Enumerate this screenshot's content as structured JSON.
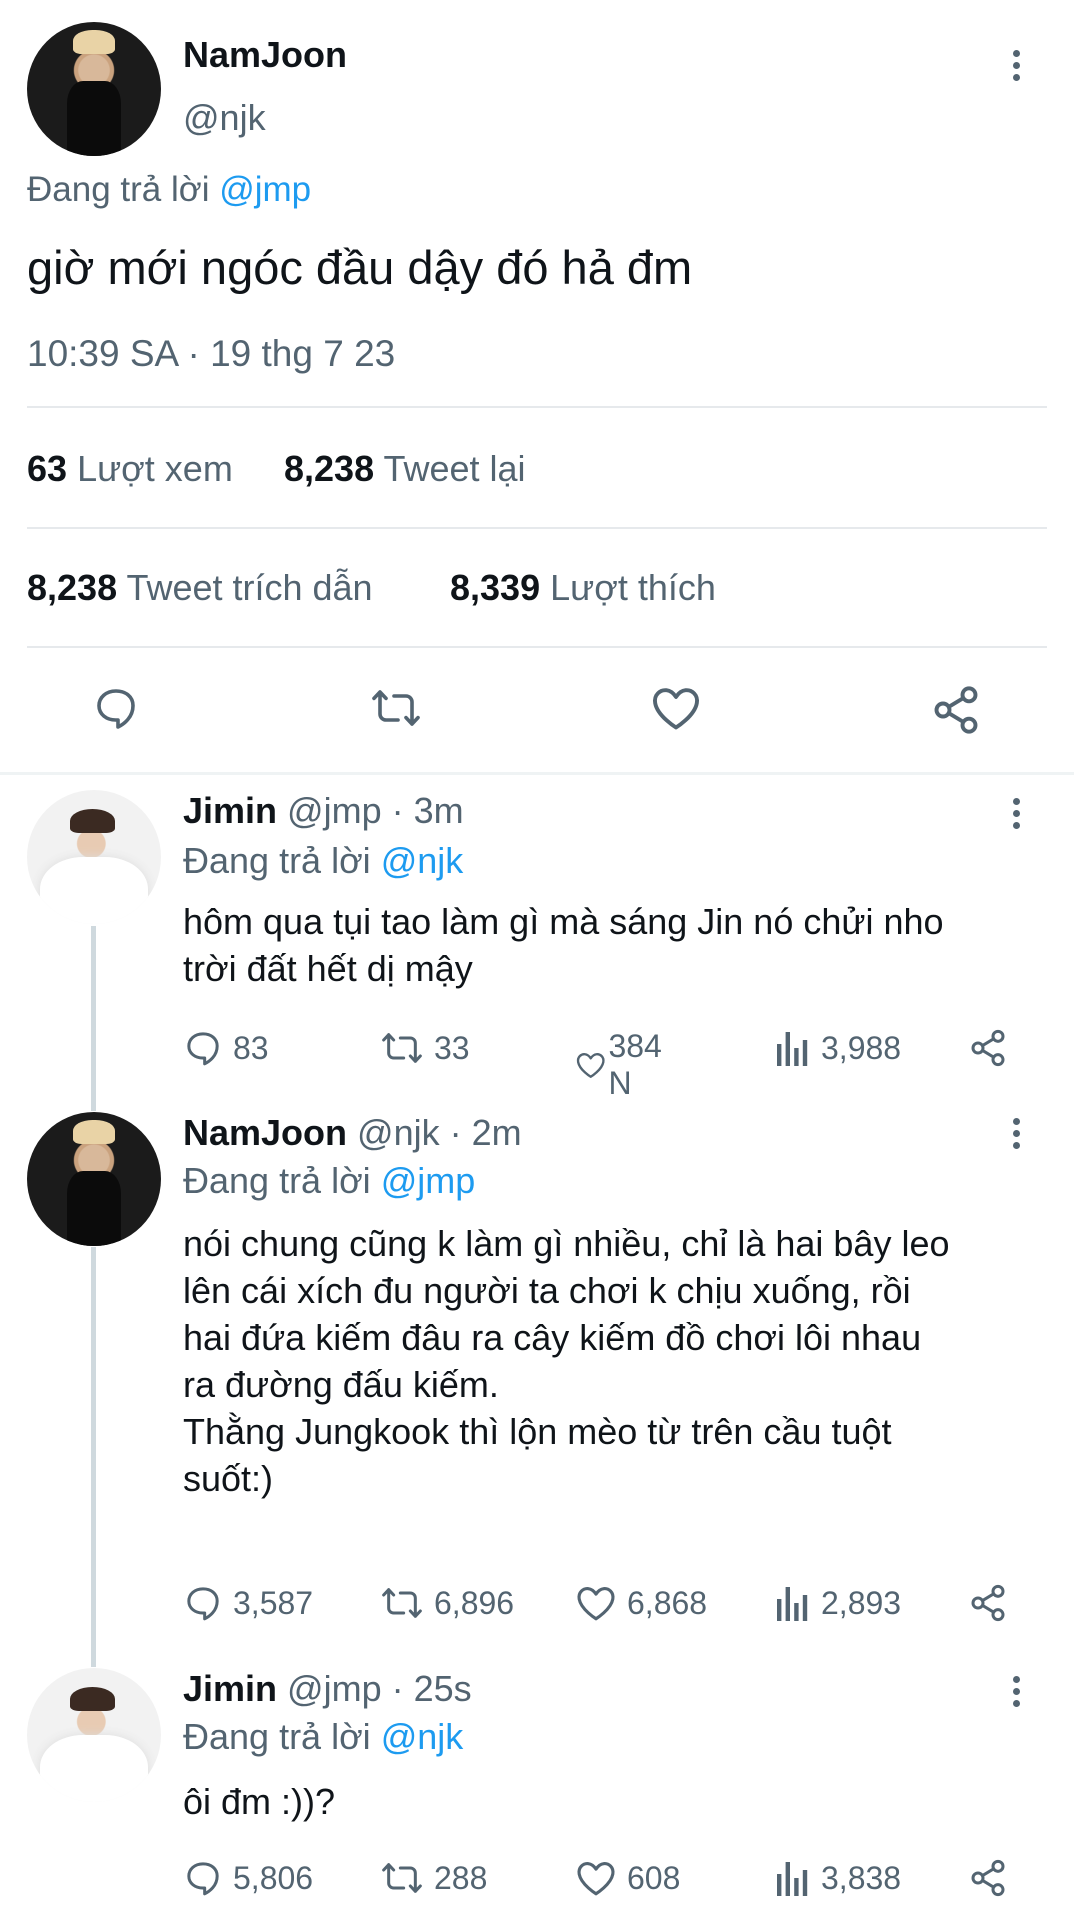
{
  "main_tweet": {
    "name": "NamJoon",
    "handle": "@njk",
    "replying_label": "Đang trả lời",
    "replying_to": "@jmp",
    "text": "giờ mới ngóc đầu dậy đó hả đm",
    "timestamp": "10:39 SA · 19 thg 7 23",
    "stats": {
      "views_count": "63",
      "views_label": "Lượt xem",
      "retweets_count": "8,238",
      "retweets_label": "Tweet lại",
      "quotes_count": "8,238",
      "quotes_label": "Tweet trích dẫn",
      "likes_count": "8,339",
      "likes_label": "Lượt thích"
    }
  },
  "replies": [
    {
      "name": "Jimin",
      "handle": "@jmp",
      "time": "· 3m",
      "replying_label": "Đang trả lời",
      "replying_to": "@njk",
      "text": "hôm qua tụi tao làm gì mà sáng Jin nó chửi nho\ntrời đất hết dị mậy",
      "replies": "83",
      "retweets": "33",
      "likes": "384 N",
      "views": "3,988"
    },
    {
      "name": "NamJoon",
      "handle": "@njk",
      "time": "· 2m",
      "replying_label": "Đang trả lời",
      "replying_to": "@jmp",
      "text": "nói chung cũng k làm gì nhiều, chỉ là hai bây leo\nlên cái xích đu người ta chơi k chịu xuống, rồi\nhai đứa kiếm đâu ra cây kiếm đồ chơi lôi nhau\nra đường đấu kiếm.\nThằng Jungkook thì lộn mèo từ trên cầu tuột\nsuốt:)",
      "replies": "3,587",
      "retweets": "6,896",
      "likes": "6,868",
      "views": "2,893"
    },
    {
      "name": "Jimin",
      "handle": "@jmp",
      "time": "· 25s",
      "replying_label": "Đang trả lời",
      "replying_to": "@njk",
      "text": "ôi đm :))?",
      "replies": "5,806",
      "retweets": "288",
      "likes": "608",
      "views": "3,838"
    }
  ]
}
